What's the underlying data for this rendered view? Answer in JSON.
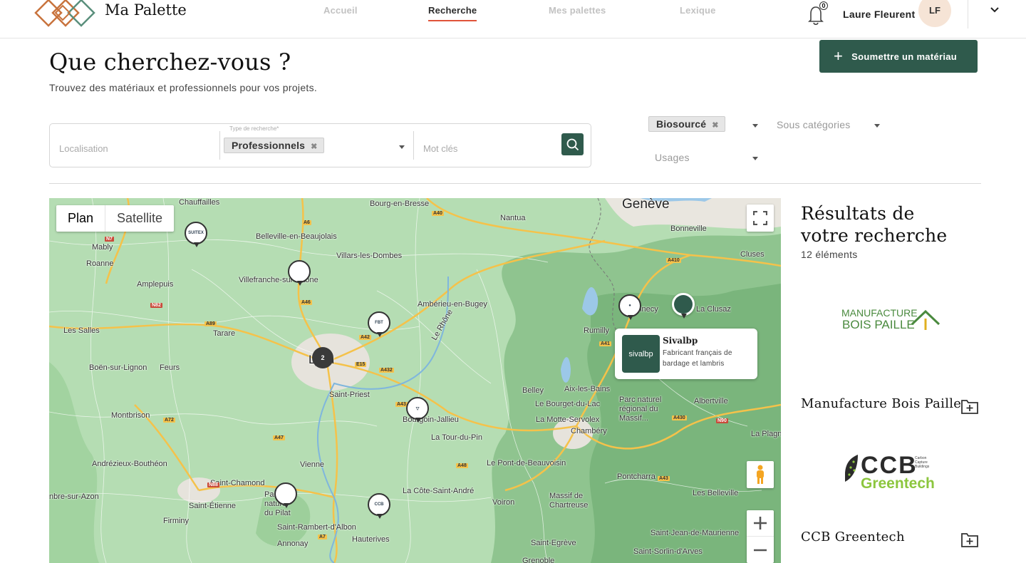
{
  "brand": {
    "name": "Ma Palette"
  },
  "nav": {
    "items": [
      {
        "label": "Accueil",
        "active": false
      },
      {
        "label": "Recherche",
        "active": true
      },
      {
        "label": "Mes palettes",
        "active": false
      },
      {
        "label": "Lexique",
        "active": false
      }
    ]
  },
  "notifications": {
    "count": "0"
  },
  "user": {
    "name": "Laure Fleurent",
    "initials": "LF"
  },
  "hero": {
    "title": "Que cherchez-vous ?",
    "subtitle": "Trouvez des matériaux et professionnels pour vos projets.",
    "submit_label": "Soumettre un matériau"
  },
  "search": {
    "location_placeholder": "Localisation",
    "type_label": "Type de recherche*",
    "type_value": "Professionnels",
    "keyword_placeholder": "Mot clés"
  },
  "filters": {
    "category_value": "Biosourcé",
    "subcategory_placeholder": "Sous catégories",
    "usages_placeholder": "Usages"
  },
  "map": {
    "mode_plan": "Plan",
    "mode_satellite": "Satellite",
    "cluster_count": "2",
    "popup": {
      "title": "Sivalbp",
      "description": "Fabricant français de bardage et lambris",
      "thumb_text": "sivalbp"
    },
    "places": [
      "Genève",
      "Lyon",
      "Chauffailles",
      "Bourg-en-Bresse",
      "Nantua",
      "Bonneville",
      "Cluses",
      "Belleville-en-Beaujolais",
      "Mably",
      "Roanne",
      "Villars-les-Dombes",
      "Villefranche-sur-Saône",
      "Amplepuis",
      "Ambérieu-en-Bugey",
      "La Clusaz",
      "Rumilly",
      "Annecy",
      "Tarare",
      "Les Salles",
      "Feurs",
      "Boën-sur-Lignon",
      "Montbrison",
      "Saint-Priest",
      "Belley",
      "Aix-les-Bains",
      "Albertville",
      "Parc naturel régional du Massif...",
      "Le Bourget-du-Lac",
      "Bourgoin-Jallieu",
      "La Tour-du-Pin",
      "La Motte-Servolex",
      "Chambéry",
      "Andrézieux-Bouthéon",
      "Vienne",
      "Le Pont-de-Beauvoisin",
      "Saint-Chamond",
      "Saint-Étienne",
      "Firminy",
      "Parc naturel du Pilat",
      "La Côte-Saint-André",
      "Voiron",
      "Massif de Chartreuse",
      "Pontcharra",
      "Les Belleville",
      "La Plagne-T",
      "Saint-Rambert-d'Albon",
      "Hauterives",
      "Saint-Jean-de-Maurienne",
      "Annonay",
      "Saint-Egrève",
      "Saint-Sorlin-d'Arves",
      "Grenoble",
      "Le Rhône",
      "nbre-sur-Azon"
    ],
    "roads": [
      "A6",
      "A40",
      "N7",
      "A46",
      "N82",
      "A89",
      "A42",
      "E15",
      "A432",
      "A43",
      "A41",
      "A410",
      "A47",
      "A72",
      "N88",
      "A48",
      "A43",
      "A430",
      "N90",
      "A7"
    ]
  },
  "results": {
    "title": "Résultats de votre recherche",
    "count": "12 éléments",
    "items": [
      {
        "name": "Manufacture Bois Paille",
        "logo_line1": "MANUFACTURE",
        "logo_line2": "BOIS PAILLE"
      },
      {
        "name": "CCB Greentech",
        "logo_main": "CCB",
        "logo_sub": "Greentech",
        "logo_tag": "Carbon Capture Buildings"
      }
    ]
  },
  "colors": {
    "primary": "#2f5a4c",
    "accent": "#e0533a",
    "map_green": "#b8dfb5"
  }
}
